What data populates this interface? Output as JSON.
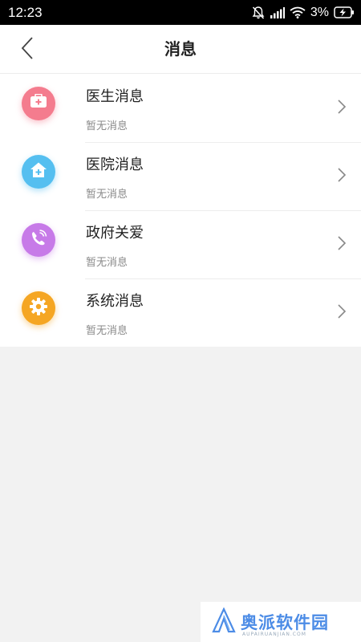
{
  "status_bar": {
    "time": "12:23",
    "battery": "3%",
    "icons": [
      "bell-off-icon",
      "signal-icon",
      "wifi-icon",
      "battery-charging-icon"
    ]
  },
  "nav": {
    "title": "消息",
    "back_icon": "chevron-left-icon"
  },
  "messages": [
    {
      "title": "医生消息",
      "subtitle": "暂无消息",
      "icon": "medical-kit-icon",
      "color": "#f47c8e"
    },
    {
      "title": "医院消息",
      "subtitle": "暂无消息",
      "icon": "hospital-icon",
      "color": "#55bff0"
    },
    {
      "title": "政府关爱",
      "subtitle": "暂无消息",
      "icon": "phone-icon",
      "color": "#c77ae8"
    },
    {
      "title": "系统消息",
      "subtitle": "暂无消息",
      "icon": "gear-icon",
      "color": "#f5a623"
    }
  ],
  "watermark": {
    "text": "奥派软件园",
    "sub": "AUPAIRUANJIAN.COM"
  }
}
